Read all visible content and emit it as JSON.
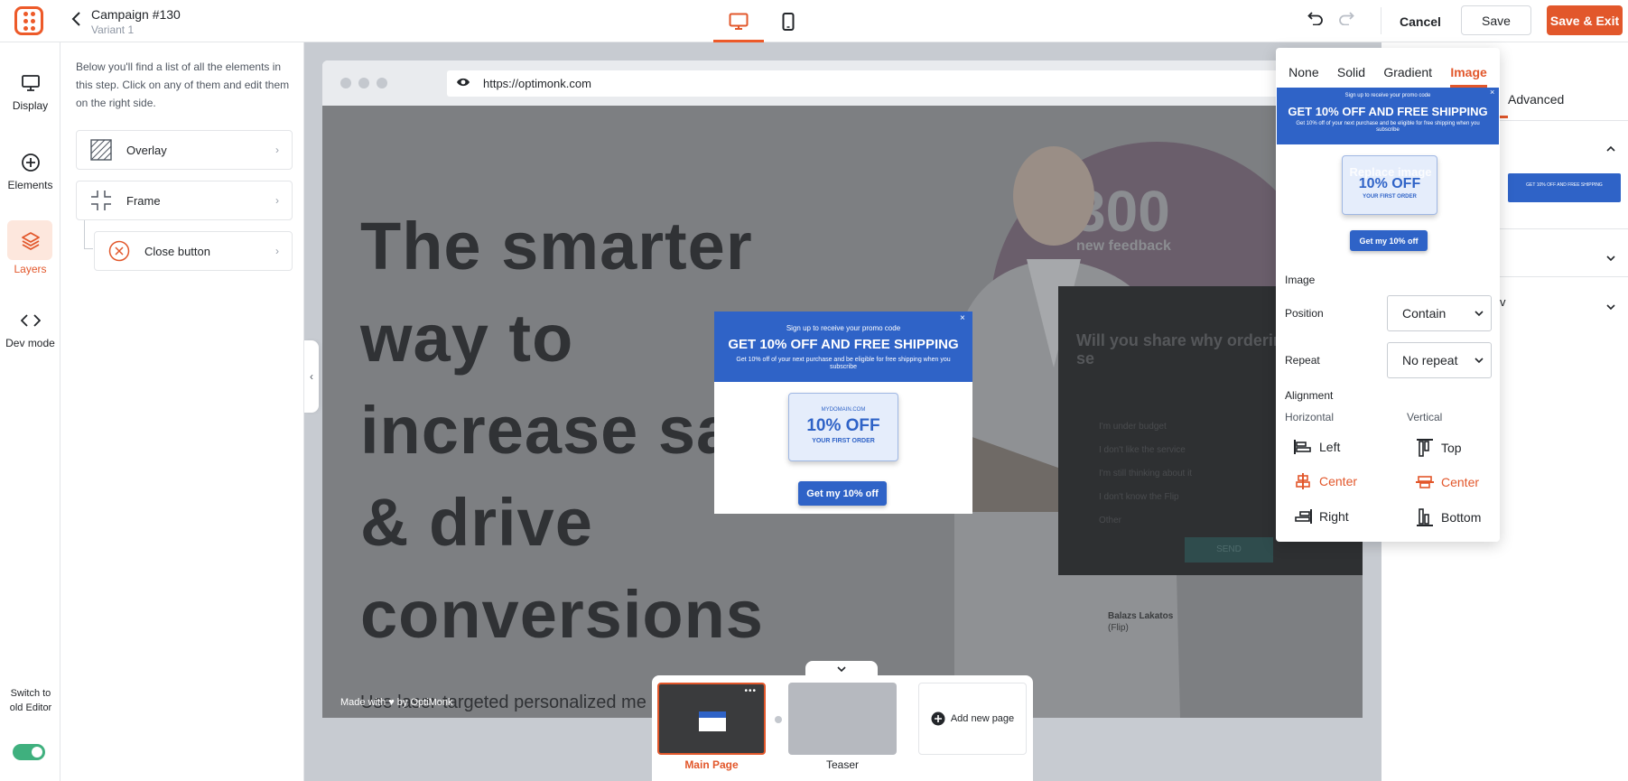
{
  "header": {
    "campaign_title": "Campaign #130",
    "variant": "Variant 1",
    "cancel_label": "Cancel",
    "save_label": "Save",
    "save_exit_label": "Save & Exit",
    "active_device": "desktop"
  },
  "rail": {
    "items": [
      {
        "label": "Display",
        "icon": "display-icon"
      },
      {
        "label": "Elements",
        "icon": "plus-circle-icon"
      },
      {
        "label": "Layers",
        "icon": "layers-icon",
        "active": true
      },
      {
        "label": "Dev mode",
        "icon": "code-icon"
      }
    ],
    "switch_label": "Switch to old Editor",
    "switch_on": true
  },
  "layers": {
    "description": "Below you'll find a list of all the elements in this step. Click on any of them and edit them on the right side.",
    "items": [
      {
        "label": "Overlay",
        "icon": "overlay-icon"
      },
      {
        "label": "Frame",
        "icon": "frame-icon"
      },
      {
        "label": "Close button",
        "icon": "close-circle-icon"
      }
    ]
  },
  "browser": {
    "url": "https://optimonk.com"
  },
  "site": {
    "hero_lines": [
      "The smarter",
      "way to",
      "increase sa",
      "& drive",
      "conversions"
    ],
    "sub": "Use laser-targeted personalized me",
    "made_with": "Made with ♥ by OptiMonk",
    "stat_number": "300",
    "stat_label": "new feedback",
    "survey_question": "Will you share why ordering the Flip se",
    "survey_options": [
      "I'm under budget",
      "I don't like the service",
      "I'm still thinking about it",
      "I don't know the Flip",
      "Other"
    ],
    "survey_button": "SEND",
    "signature_name": "Balazs Lakatos",
    "signature_role": "(Flip)"
  },
  "popup": {
    "small": "Sign up to receive your promo code",
    "headline": "GET 10% OFF AND FREE SHIPPING",
    "fine": "Get 10% off of your next purchase and be eligible for free shipping when you subscribe",
    "coupon_domain": "MYDOMAIN.COM",
    "coupon_off": "10% OFF",
    "coupon_first": "YOUR FIRST ORDER",
    "button": "Get my 10% off",
    "close": "×"
  },
  "pages": {
    "items": [
      {
        "label": "Main Page",
        "active": true
      },
      {
        "label": "Teaser",
        "active": false
      }
    ],
    "add_label": "Add new page",
    "more": "•••"
  },
  "right_sidebar": {
    "advanced_tab": "Advanced",
    "partial_char": "v"
  },
  "background_popover": {
    "tabs": [
      "None",
      "Solid",
      "Gradient",
      "Image"
    ],
    "active_tab": "Image",
    "preview_overlay_text": "Replace image",
    "image_section": "Image",
    "position_label": "Position",
    "position_value": "Contain",
    "repeat_label": "Repeat",
    "repeat_value": "No repeat",
    "alignment_section": "Alignment",
    "horizontal_label": "Horizontal",
    "vertical_label": "Vertical",
    "horizontal_options": [
      "Left",
      "Center",
      "Right"
    ],
    "vertical_options": [
      "Top",
      "Center",
      "Bottom"
    ],
    "horizontal_active": "Center",
    "vertical_active": "Center"
  },
  "colors": {
    "accent": "#e2572b",
    "popup_blue": "#2f63c7",
    "toggle_green": "#3fb07e"
  }
}
